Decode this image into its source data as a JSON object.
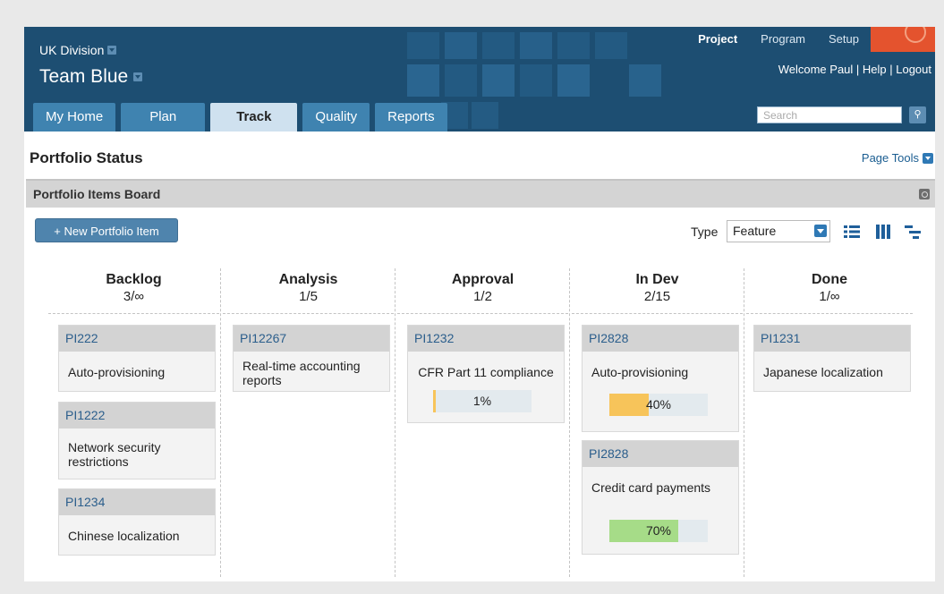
{
  "header": {
    "division": "UK Division",
    "team": "Team Blue",
    "context_tabs": [
      "Project",
      "Program",
      "Setup"
    ],
    "welcome": "Welcome Paul | Help | Logout",
    "nav_tabs": [
      "My Home",
      "Plan",
      "Track",
      "Quality",
      "Reports"
    ],
    "active_nav": "Track",
    "search_placeholder": "Search",
    "colors": {
      "header_bg": "#1d4e72",
      "tab": "#3f83b0",
      "tab_active": "#cfe1ef",
      "logo": "#e4532e"
    }
  },
  "page": {
    "title": "Portfolio Status",
    "tools": "Page Tools"
  },
  "panel": {
    "title": "Portfolio Items Board",
    "new_button": "+ New Portfolio Item",
    "type_label": "Type",
    "type_value": "Feature",
    "view_icons": [
      "list-view-icon",
      "column-view-icon",
      "gantt-view-icon"
    ]
  },
  "columns": [
    {
      "name": "Backlog",
      "count": "3/∞"
    },
    {
      "name": "Analysis",
      "count": "1/5"
    },
    {
      "name": "Approval",
      "count": "1/2"
    },
    {
      "name": "In Dev",
      "count": "2/15"
    },
    {
      "name": "Done",
      "count": "1/∞"
    }
  ],
  "cards": {
    "backlog": [
      {
        "id": "PI222",
        "title": "Auto-provisioning"
      },
      {
        "id": "PI1222",
        "title": "Network security restrictions"
      },
      {
        "id": "PI1234",
        "title": "Chinese localization"
      }
    ],
    "analysis": [
      {
        "id": "PI12267",
        "title": "Real-time accounting reports"
      }
    ],
    "approval": [
      {
        "id": "PI1232",
        "title": "CFR Part 11 compliance",
        "progress_label": "1%",
        "progress": 0.01,
        "color": "#f7c45a"
      }
    ],
    "indev": [
      {
        "id": "PI2828",
        "title": "Auto-provisioning",
        "progress_label": "40%",
        "progress": 0.4,
        "color": "#f7c45a"
      },
      {
        "id": "PI2828",
        "title": "Credit card payments",
        "progress_label": "70%",
        "progress": 0.7,
        "color": "#a6dc88"
      }
    ],
    "done": [
      {
        "id": "PI1231",
        "title": "Japanese localization"
      }
    ]
  }
}
